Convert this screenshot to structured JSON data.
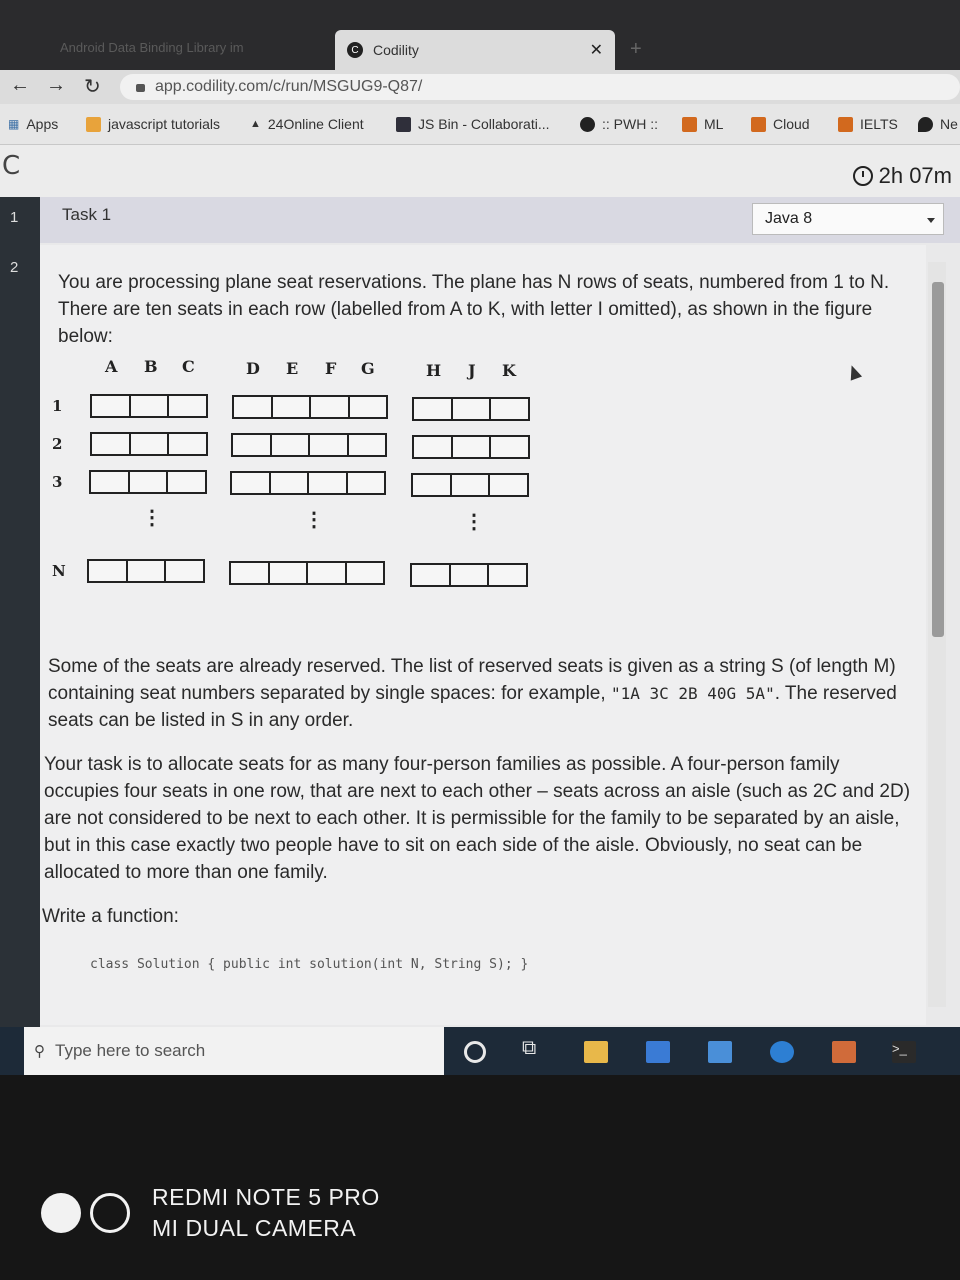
{
  "browser": {
    "inactive_tab": "Android Data Binding Library im",
    "active_tab": "Codility",
    "url": "app.codility.com/c/run/MSGUG9-Q87/",
    "bookmarks": [
      "Apps",
      "javascript tutorials",
      "24Online Client",
      "JS Bin - Collaborati...",
      ":: PWH ::",
      "ML",
      "Cloud",
      "IELTS",
      "Ne"
    ]
  },
  "app": {
    "logo": "C",
    "timer": "2h 07m",
    "rail_numbers": [
      "1",
      "2"
    ],
    "task_label": "Task 1",
    "language": "Java 8"
  },
  "task": {
    "intro": "You are processing plane seat reservations. The plane has N rows of seats, numbered from 1 to N. There are ten seats in each row (labelled from A to K, with letter I omitted), as shown in the figure below:",
    "figure": {
      "columns": [
        "A",
        "B",
        "C",
        "D",
        "E",
        "F",
        "G",
        "H",
        "J",
        "K"
      ],
      "rows": [
        "1",
        "2",
        "3",
        "N"
      ],
      "ellipsis": "⋮"
    },
    "para2_pre": "Some of the seats are already reserved. The list of reserved seats is given as a string S (of length M) containing seat numbers separated by single spaces: for example, ",
    "example": "\"1A 3C 2B 40G 5A\"",
    "para2_post": ". The reserved seats can be listed in S in any order.",
    "para3": "Your task is to allocate seats for as many four-person families as possible. A four-person family occupies four seats in one row, that are next to each other – seats across an aisle (such as 2C and 2D) are not considered to be next to each other. It is permissible for the family to be separated by an aisle, but in this case exactly two people have to sit on each side of the aisle. Obviously, no seat can be allocated to more than one family.",
    "write": "Write a function:",
    "code": "class Solution { public int solution(int N, String S); }"
  },
  "windows": {
    "search_placeholder": "Type here to search"
  },
  "watermark": {
    "line1": "REDMI NOTE 5 PRO",
    "line2": "MI DUAL CAMERA"
  },
  "colors": {
    "rail": "#2b3137",
    "task_bar": "#d9d9e2",
    "win_taskbar": "#1d2a38"
  }
}
